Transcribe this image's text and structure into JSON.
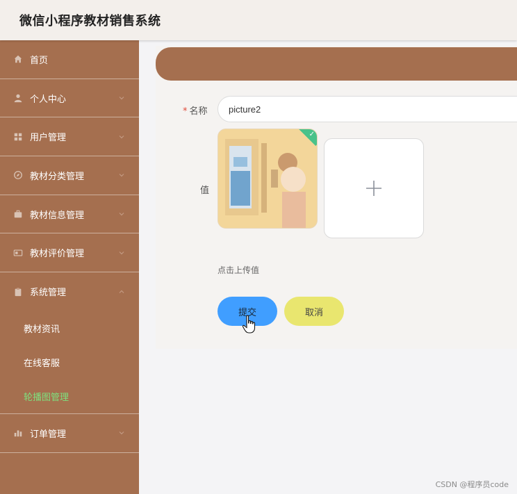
{
  "header": {
    "title": "微信小程序教材销售系统"
  },
  "sidebar": {
    "items": [
      {
        "label": "首页",
        "icon": "home-icon",
        "has_chevron": false
      },
      {
        "label": "个人中心",
        "icon": "user-icon",
        "has_chevron": true
      },
      {
        "label": "用户管理",
        "icon": "grid-icon",
        "has_chevron": true
      },
      {
        "label": "教材分类管理",
        "icon": "compass-icon",
        "has_chevron": true
      },
      {
        "label": "教材信息管理",
        "icon": "briefcase-icon",
        "has_chevron": true
      },
      {
        "label": "教材评价管理",
        "icon": "card-icon",
        "has_chevron": true
      },
      {
        "label": "系统管理",
        "icon": "clipboard-icon",
        "has_chevron": true,
        "expanded": true
      },
      {
        "label": "订单管理",
        "icon": "bar-chart-icon",
        "has_chevron": true
      }
    ],
    "sub_items": [
      {
        "label": "教材资讯",
        "active": false
      },
      {
        "label": "在线客服",
        "active": false
      },
      {
        "label": "轮播图管理",
        "active": true
      }
    ]
  },
  "form": {
    "name_label": "名称",
    "required_mark": "*",
    "name_value": "picture2",
    "value_label": "值",
    "upload_tip": "点击上传值",
    "submit_label": "提交",
    "cancel_label": "取消"
  },
  "watermark": "CSDN @程序员code",
  "colors": {
    "sidebar": "#a56f4f",
    "active_sub_item": "#7ee07e",
    "submit": "#409eff",
    "cancel": "#e9e66f",
    "upload_success": "#49c28a"
  }
}
